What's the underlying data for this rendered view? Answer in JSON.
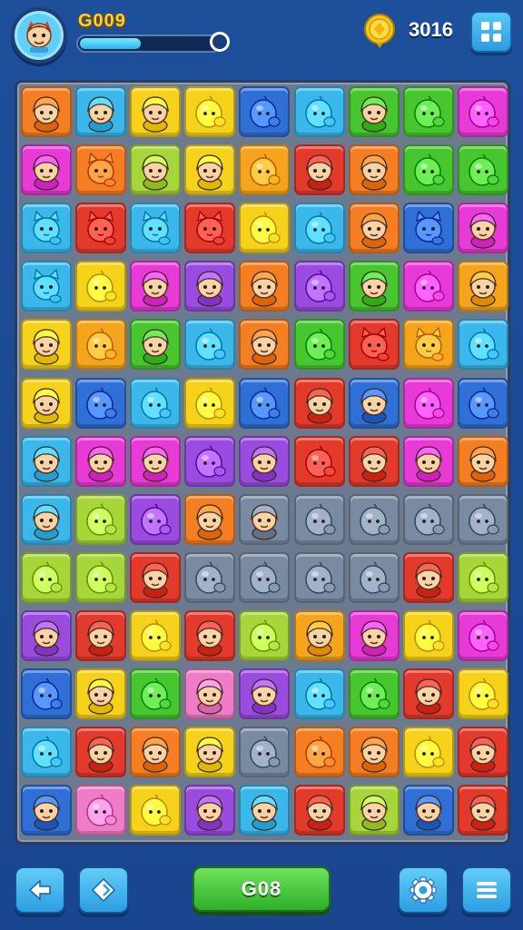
{
  "header": {
    "level_label": "G009",
    "progress_fraction": 0.44,
    "coins": "3016",
    "avatar_icon": "avatar-character-icon",
    "coin_icon": "gold-coin-icon",
    "menu_icon": "grid-menu-icon"
  },
  "board": {
    "columns": 9,
    "rows": 13,
    "palette": {
      "O": "#f57e22",
      "C": "#3ab8ec",
      "Y": "#f7d21a",
      "B": "#2f6fd6",
      "P": "#9a4ce0",
      "G": "#47c62f",
      "M": "#e83ad6",
      "R": "#e33a2c",
      "A": "#f5a51c",
      "L": "#a6d63a",
      "T": "#39c6c2",
      "K": "#f07bc6",
      "D": "#7a8aa0"
    },
    "tiles": [
      [
        "O",
        "C",
        "Y",
        "Y",
        "B",
        "C",
        "G",
        "G",
        "M"
      ],
      [
        "M",
        "O",
        "L",
        "Y",
        "A",
        "R",
        "O",
        "G",
        "G"
      ],
      [
        "C",
        "R",
        "C",
        "R",
        "Y",
        "C",
        "O",
        "B",
        "M"
      ],
      [
        "C",
        "Y",
        "M",
        "P",
        "O",
        "P",
        "G",
        "M",
        "A"
      ],
      [
        "Y",
        "A",
        "G",
        "C",
        "O",
        "G",
        "R",
        "A",
        "C"
      ],
      [
        "Y",
        "B",
        "C",
        "Y",
        "B",
        "R",
        "B",
        "M",
        "B"
      ],
      [
        "C",
        "M",
        "M",
        "P",
        "P",
        "R",
        "R",
        "M",
        "O"
      ],
      [
        "C",
        "L",
        "P",
        "O",
        "D",
        "D",
        "D",
        "D",
        "D"
      ],
      [
        "L",
        "L",
        "R",
        "D",
        "D",
        "D",
        "D",
        "R",
        "L"
      ],
      [
        "P",
        "R",
        "Y",
        "R",
        "L",
        "A",
        "M",
        "Y",
        "M"
      ],
      [
        "B",
        "Y",
        "G",
        "K",
        "P",
        "C",
        "G",
        "R",
        "Y"
      ],
      [
        "C",
        "R",
        "O",
        "Y",
        "D",
        "O",
        "O",
        "Y",
        "R"
      ],
      [
        "B",
        "K",
        "Y",
        "P",
        "C",
        "R",
        "L",
        "B",
        "R"
      ]
    ],
    "creatures": [
      [
        "kid",
        "kid",
        "kid",
        "blob",
        "blob",
        "blob",
        "kid",
        "blob",
        "blob"
      ],
      [
        "kid",
        "cat",
        "kid",
        "kid",
        "blob",
        "kid",
        "kid",
        "blob",
        "blob"
      ],
      [
        "cat",
        "cat",
        "cat",
        "cat",
        "blob",
        "blob",
        "kid",
        "cat",
        "kid"
      ],
      [
        "cat",
        "blob",
        "kid",
        "kid",
        "kid",
        "blob",
        "kid",
        "blob",
        "kid"
      ],
      [
        "kid",
        "blob",
        "kid",
        "blob",
        "kid",
        "blob",
        "cat",
        "cat",
        "blob"
      ],
      [
        "kid",
        "blob",
        "blob",
        "blob",
        "blob",
        "kid",
        "kid",
        "blob",
        "blob"
      ],
      [
        "kid",
        "kid",
        "kid",
        "blob",
        "kid",
        "blob",
        "kid",
        "kid",
        "kid"
      ],
      [
        "kid",
        "blob",
        "blob",
        "kid",
        "kid",
        "blob",
        "blob",
        "blob",
        "blob"
      ],
      [
        "blob",
        "blob",
        "kid",
        "blob",
        "blob",
        "blob",
        "blob",
        "kid",
        "blob"
      ],
      [
        "kid",
        "kid",
        "blob",
        "kid",
        "blob",
        "kid",
        "kid",
        "blob",
        "blob"
      ],
      [
        "blob",
        "kid",
        "blob",
        "kid",
        "kid",
        "blob",
        "blob",
        "kid",
        "blob"
      ],
      [
        "blob",
        "kid",
        "kid",
        "kid",
        "blob",
        "blob",
        "kid",
        "blob",
        "kid"
      ],
      [
        "kid",
        "blob",
        "blob",
        "kid",
        "kid",
        "kid",
        "kid",
        "kid",
        "kid"
      ]
    ]
  },
  "footer": {
    "back_icon": "arrow-left-icon",
    "hint_icon": "diamond-hint-icon",
    "go_label": "G08",
    "settings_icon": "gear-icon",
    "menu_icon": "hamburger-menu-icon"
  }
}
